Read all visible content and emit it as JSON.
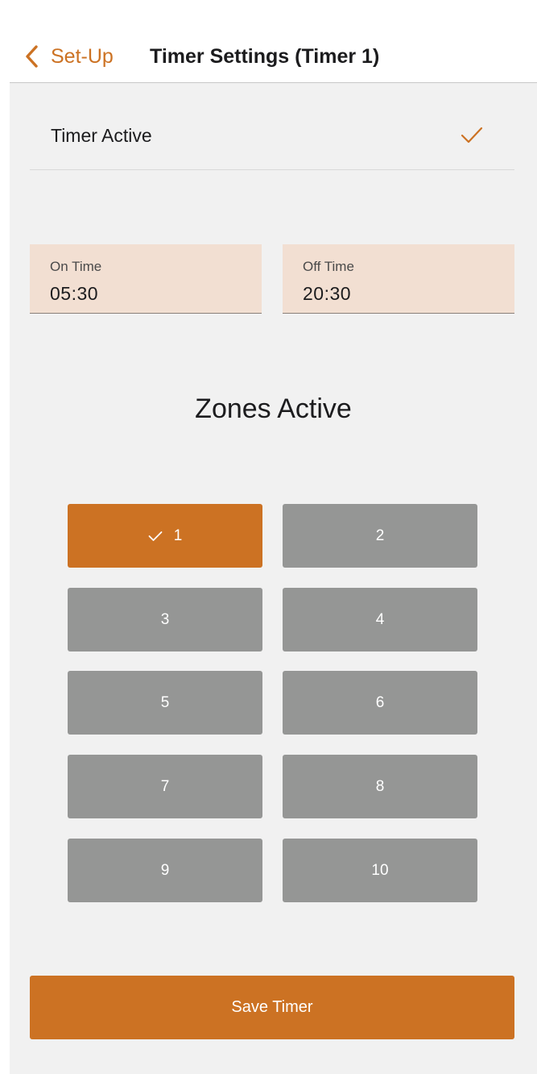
{
  "header": {
    "back_label": "Set-Up",
    "title": "Timer Settings (Timer 1)"
  },
  "timer_active": {
    "label": "Timer Active",
    "checked": true
  },
  "on_time": {
    "label": "On Time",
    "value": "05:30"
  },
  "off_time": {
    "label": "Off Time",
    "value": "20:30"
  },
  "zones": {
    "heading": "Zones Active",
    "items": [
      {
        "label": "1",
        "selected": true
      },
      {
        "label": "2",
        "selected": false
      },
      {
        "label": "3",
        "selected": false
      },
      {
        "label": "4",
        "selected": false
      },
      {
        "label": "5",
        "selected": false
      },
      {
        "label": "6",
        "selected": false
      },
      {
        "label": "7",
        "selected": false
      },
      {
        "label": "8",
        "selected": false
      },
      {
        "label": "9",
        "selected": false
      },
      {
        "label": "10",
        "selected": false
      }
    ]
  },
  "save_label": "Save Timer",
  "colors": {
    "accent": "#cc7223",
    "zone_inactive": "#959695",
    "field_background": "#f2dfd2",
    "content_background": "#f1f1f1"
  },
  "icons": {
    "back": "chevron-left-icon",
    "timer_active": "checkmark-icon",
    "zone_selected": "checkmark-icon"
  }
}
